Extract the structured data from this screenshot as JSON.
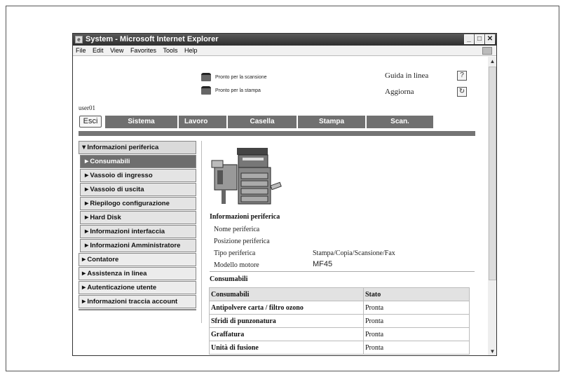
{
  "window": {
    "title": "System - Microsoft Internet Explorer",
    "controls": {
      "minimize": "_",
      "maximize": "□",
      "close": "✕"
    }
  },
  "menubar": {
    "items": [
      "File",
      "Edit",
      "View",
      "Favorites",
      "Tools",
      "Help"
    ]
  },
  "status": {
    "scan": "Pronto per la scansione",
    "print": "Pronto per la stampa"
  },
  "links": {
    "help": "Guida in linea",
    "refresh": "Aggiorna",
    "help_icon": "?",
    "refresh_icon": "↻"
  },
  "user": "user01",
  "logout_label": "Esci",
  "tabs": [
    "Sistema",
    "Lavoro",
    "Casella",
    "Stampa",
    "Scan."
  ],
  "nav": {
    "section_title": "▼Informazioni periferica",
    "sub_items": [
      "►Consumabili",
      "►Vassoio di ingresso",
      "►Vassoio di uscita",
      "►Riepilogo configurazione",
      "►Hard Disk",
      "►Informazioni interfaccia",
      "►Informazioni Amministratore"
    ],
    "sections": [
      "►Contatore",
      "►Assistenza in linea",
      "►Autenticazione utente",
      "►Informazioni traccia account"
    ]
  },
  "device_info": {
    "title": "Informazioni periferica",
    "rows": [
      {
        "label": "Nome periferica",
        "value": ""
      },
      {
        "label": "Posizione periferica",
        "value": ""
      },
      {
        "label": "Tipo periferica",
        "value": "Stampa/Copia/Scansione/Fax"
      },
      {
        "label": "Modello motore",
        "value": "MF45"
      }
    ]
  },
  "consumables": {
    "title": "Consumabili",
    "headers": [
      "Consumabili",
      "Stato"
    ],
    "rows": [
      [
        "Antipolvere carta / filtro ozono",
        "Pronta"
      ],
      [
        "Sfridi di punzonatura",
        "Pronta"
      ],
      [
        "Graffatura",
        "Pronta"
      ],
      [
        "Unità di fusione",
        "Pronta"
      ]
    ]
  },
  "colors": {
    "tab_bg": "#707070",
    "active_nav": "#6e6e6e",
    "bar": "#747474"
  }
}
